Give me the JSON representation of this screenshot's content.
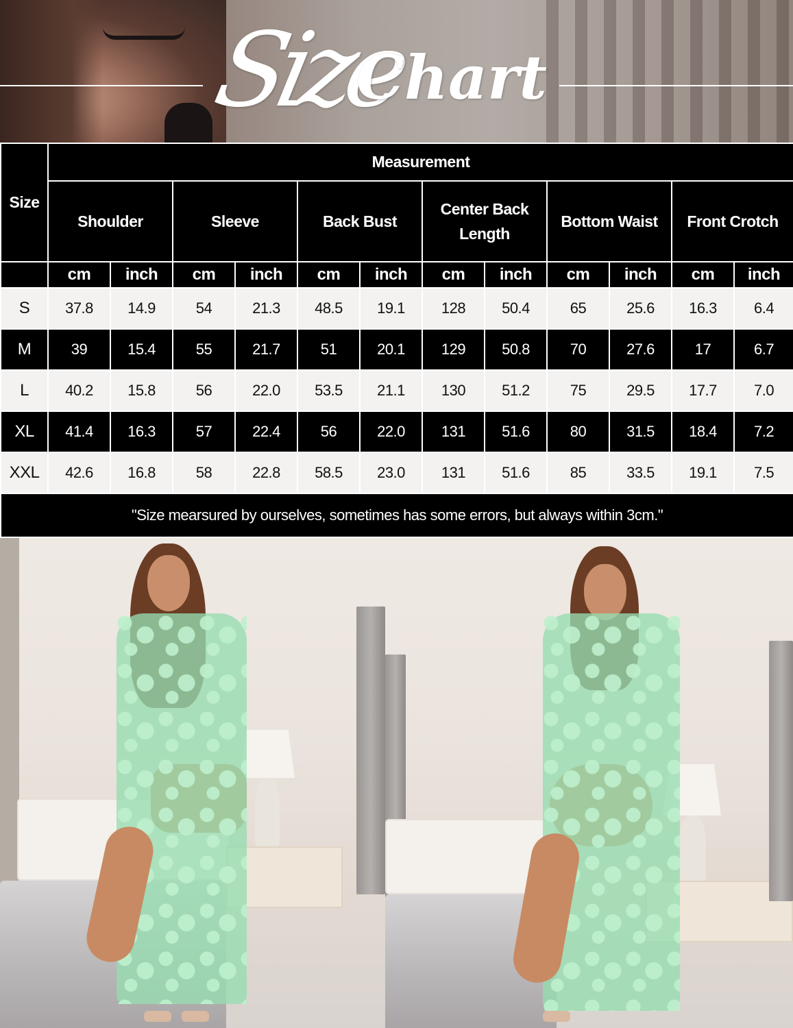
{
  "banner": {
    "script_word": "Size",
    "bold_word": "Chart"
  },
  "table": {
    "size_header": "Size",
    "measurement_header": "Measurement",
    "columns": [
      "Shoulder",
      "Sleeve",
      "Back Bust",
      "Center Back Length",
      "Bottom Waist",
      "Front Crotch"
    ],
    "units": [
      "cm",
      "inch"
    ],
    "rows": [
      {
        "size": "S",
        "values": [
          "37.8",
          "14.9",
          "54",
          "21.3",
          "48.5",
          "19.1",
          "128",
          "50.4",
          "65",
          "25.6",
          "16.3",
          "6.4"
        ]
      },
      {
        "size": "M",
        "values": [
          "39",
          "15.4",
          "55",
          "21.7",
          "51",
          "20.1",
          "129",
          "50.8",
          "70",
          "27.6",
          "17",
          "6.7"
        ]
      },
      {
        "size": "L",
        "values": [
          "40.2",
          "15.8",
          "56",
          "22.0",
          "53.5",
          "21.1",
          "130",
          "51.2",
          "75",
          "29.5",
          "17.7",
          "7.0"
        ]
      },
      {
        "size": "XL",
        "values": [
          "41.4",
          "16.3",
          "57",
          "22.4",
          "56",
          "22.0",
          "131",
          "51.6",
          "80",
          "31.5",
          "18.4",
          "7.2"
        ]
      },
      {
        "size": "XXL",
        "values": [
          "42.6",
          "16.8",
          "58",
          "22.8",
          "58.5",
          "23.0",
          "131",
          "51.6",
          "85",
          "33.5",
          "19.1",
          "7.5"
        ]
      }
    ],
    "note": "\"Size mearsured by ourselves, sometimes has some errors, but always within 3cm.\""
  },
  "colors": {
    "dark_row": "#000000",
    "light_row": "#f3f2f1",
    "robe": "#96dcaf"
  }
}
